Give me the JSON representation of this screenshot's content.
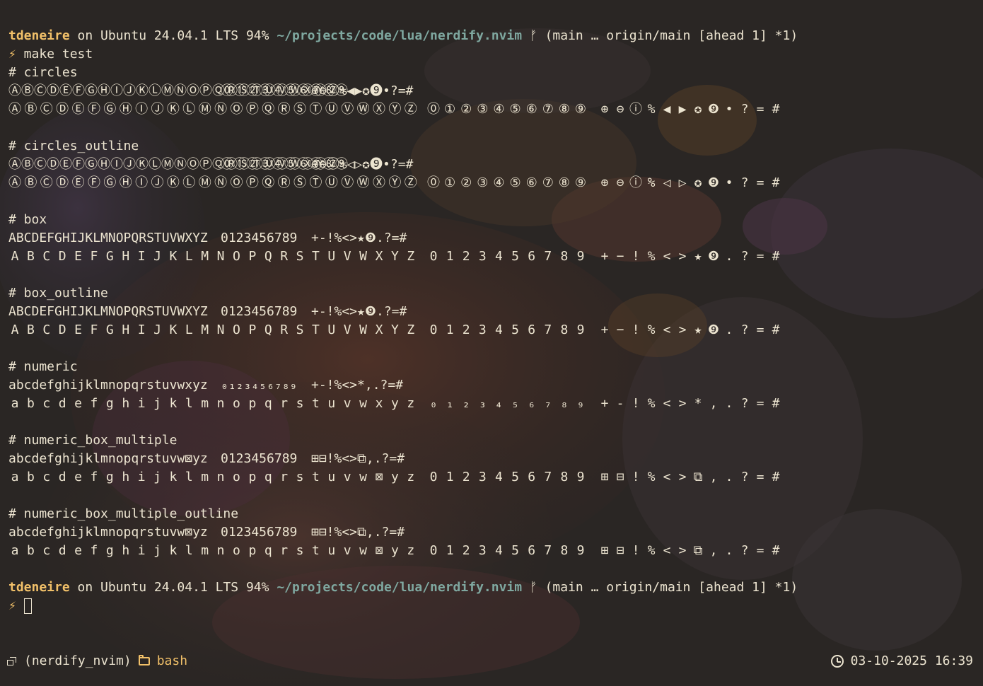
{
  "prompt": {
    "user": "tdeneire",
    "on_text": " on Ubuntu 24.04.1 LTS 94% ",
    "path": "~/projects/code/lua/nerdify.nvim",
    "git": " ᚠ (main … origin/main [ahead 1] *1)",
    "bolt": "⚡",
    "command": " make test"
  },
  "sections": [
    {
      "title": "# circles",
      "compact": [
        "ⒶⒷⒸⒹⒺⒻⒼⒽⒾⒿⓀⓁⓂⓃⓄⓅⓆⓇⓈⓉⓊⓋⓌⓍⓎⓏ",
        "⓪①②③④⑤⑥⑦⑧⑨",
        "⊕⊖ⓘ%◀▶✪❾•?=#"
      ],
      "letters": [
        "Ⓐ",
        "Ⓑ",
        "Ⓒ",
        "Ⓓ",
        "Ⓔ",
        "Ⓕ",
        "Ⓖ",
        "Ⓗ",
        "Ⓘ",
        "Ⓙ",
        "Ⓚ",
        "Ⓛ",
        "Ⓜ",
        "Ⓝ",
        "Ⓞ",
        "Ⓟ",
        "Ⓠ",
        "Ⓡ",
        "Ⓢ",
        "Ⓣ",
        "Ⓤ",
        "Ⓥ",
        "Ⓦ",
        "Ⓧ",
        "Ⓨ",
        "Ⓩ"
      ],
      "digits": [
        "⓪",
        "①",
        "②",
        "③",
        "④",
        "⑤",
        "⑥",
        "⑦",
        "⑧",
        "⑨"
      ],
      "symbols": [
        "⊕",
        "⊖",
        "ⓘ",
        "%",
        "◀",
        "▶",
        "✪",
        "❾",
        "•",
        "?",
        "=",
        "#"
      ]
    },
    {
      "title": "# circles_outline",
      "compact": [
        "ⒶⒷⒸⒹⒺⒻⒼⒽⒾⒿⓀⓁⓂⓃⓄⓅⓆⓇⓈⓉⓊⓋⓌⓍⓎⓏ",
        "⓪①②③④⑤⑥⑦⑧⑨",
        "⊕⊖ⓘ%◁▷✪❾•?=#"
      ],
      "letters": [
        "Ⓐ",
        "Ⓑ",
        "Ⓒ",
        "Ⓓ",
        "Ⓔ",
        "Ⓕ",
        "Ⓖ",
        "Ⓗ",
        "Ⓘ",
        "Ⓙ",
        "Ⓚ",
        "Ⓛ",
        "Ⓜ",
        "Ⓝ",
        "Ⓞ",
        "Ⓟ",
        "Ⓠ",
        "Ⓡ",
        "Ⓢ",
        "Ⓣ",
        "Ⓤ",
        "Ⓥ",
        "Ⓦ",
        "Ⓧ",
        "Ⓨ",
        "Ⓩ"
      ],
      "digits": [
        "⓪",
        "①",
        "②",
        "③",
        "④",
        "⑤",
        "⑥",
        "⑦",
        "⑧",
        "⑨"
      ],
      "symbols": [
        "⊕",
        "⊖",
        "ⓘ",
        "%",
        "◁",
        "▷",
        "✪",
        "❾",
        "•",
        "?",
        "=",
        "#"
      ]
    },
    {
      "title": "# box",
      "compact": [
        "ABCDEFGHIJKLMNOPQRSTUVWXYZ",
        "0123456789",
        "+-!%<>★❾.?=#"
      ],
      "letters": [
        "A",
        "B",
        "C",
        "D",
        "E",
        "F",
        "G",
        "H",
        "I",
        "J",
        "K",
        "L",
        "M",
        "N",
        "O",
        "P",
        "Q",
        "R",
        "S",
        "T",
        "U",
        "V",
        "W",
        "X",
        "Y",
        "Z"
      ],
      "digits": [
        "0",
        "1",
        "2",
        "3",
        "4",
        "5",
        "6",
        "7",
        "8",
        "9"
      ],
      "symbols": [
        "+",
        "−",
        "!",
        "%",
        "<",
        ">",
        "★",
        "❾",
        ".",
        "?",
        "=",
        "#"
      ]
    },
    {
      "title": "# box_outline",
      "compact": [
        "ABCDEFGHIJKLMNOPQRSTUVWXYZ",
        "0123456789",
        "+-!%<>★❾.?=#"
      ],
      "letters": [
        "A",
        "B",
        "C",
        "D",
        "E",
        "F",
        "G",
        "H",
        "I",
        "J",
        "K",
        "L",
        "M",
        "N",
        "O",
        "P",
        "Q",
        "R",
        "S",
        "T",
        "U",
        "V",
        "W",
        "X",
        "Y",
        "Z"
      ],
      "digits": [
        "0",
        "1",
        "2",
        "3",
        "4",
        "5",
        "6",
        "7",
        "8",
        "9"
      ],
      "symbols": [
        "+",
        "−",
        "!",
        "%",
        "<",
        ">",
        "★",
        "❾",
        ".",
        "?",
        "=",
        "#"
      ]
    },
    {
      "title": "# numeric",
      "compact": [
        "abcdefghijklmnopqrstuvwxyz",
        "₀₁₂₃₄₅₆₇₈₉",
        "+-!%<>*,.?=#"
      ],
      "letters": [
        "a",
        "b",
        "c",
        "d",
        "e",
        "f",
        "g",
        "h",
        "i",
        "j",
        "k",
        "l",
        "m",
        "n",
        "o",
        "p",
        "q",
        "r",
        "s",
        "t",
        "u",
        "v",
        "w",
        "x",
        "y",
        "z"
      ],
      "digits": [
        "₀",
        "₁",
        "₂",
        "₃",
        "₄",
        "₅",
        "₆",
        "₇",
        "₈",
        "₉"
      ],
      "symbols": [
        "+",
        "-",
        "!",
        "%",
        "<",
        ">",
        "*",
        ",",
        ".",
        "?",
        "=",
        "#"
      ]
    },
    {
      "title": "# numeric_box_multiple",
      "compact": [
        "abcdefghijklmnopqrstuvw⊠yz",
        "0123456789",
        "⊞⊟!%<>⧉,.?=#"
      ],
      "letters": [
        "a",
        "b",
        "c",
        "d",
        "e",
        "f",
        "g",
        "h",
        "i",
        "j",
        "k",
        "l",
        "m",
        "n",
        "o",
        "p",
        "q",
        "r",
        "s",
        "t",
        "u",
        "v",
        "w",
        "⊠",
        "y",
        "z"
      ],
      "digits": [
        "0",
        "1",
        "2",
        "3",
        "4",
        "5",
        "6",
        "7",
        "8",
        "9"
      ],
      "symbols": [
        "⊞",
        "⊟",
        "!",
        "%",
        "<",
        ">",
        "⧉",
        ",",
        ".",
        "?",
        "=",
        "#"
      ]
    },
    {
      "title": "# numeric_box_multiple_outline",
      "compact": [
        "abcdefghijklmnopqrstuvw⊠yz",
        "0123456789",
        "⊞⊟!%<>⧉,.?=#"
      ],
      "letters": [
        "a",
        "b",
        "c",
        "d",
        "e",
        "f",
        "g",
        "h",
        "i",
        "j",
        "k",
        "l",
        "m",
        "n",
        "o",
        "p",
        "q",
        "r",
        "s",
        "t",
        "u",
        "v",
        "w",
        "⊠",
        "y",
        "z"
      ],
      "digits": [
        "0",
        "1",
        "2",
        "3",
        "4",
        "5",
        "6",
        "7",
        "8",
        "9"
      ],
      "symbols": [
        "⊞",
        "⊟",
        "!",
        "%",
        "<",
        ">",
        "⧉",
        ",",
        ".",
        "?",
        "=",
        "#"
      ]
    }
  ],
  "status": {
    "session": "(nerdify_nvim)",
    "window": "bash",
    "datetime": "03-10-2025 16:39"
  },
  "icons": {
    "session": "session-icon",
    "window": "folder-icon",
    "clock": "clock-icon"
  },
  "colors": {
    "user": "#f1c069",
    "path": "#7fa8a0",
    "text": "#ece4d0",
    "background": "#2a2624"
  }
}
